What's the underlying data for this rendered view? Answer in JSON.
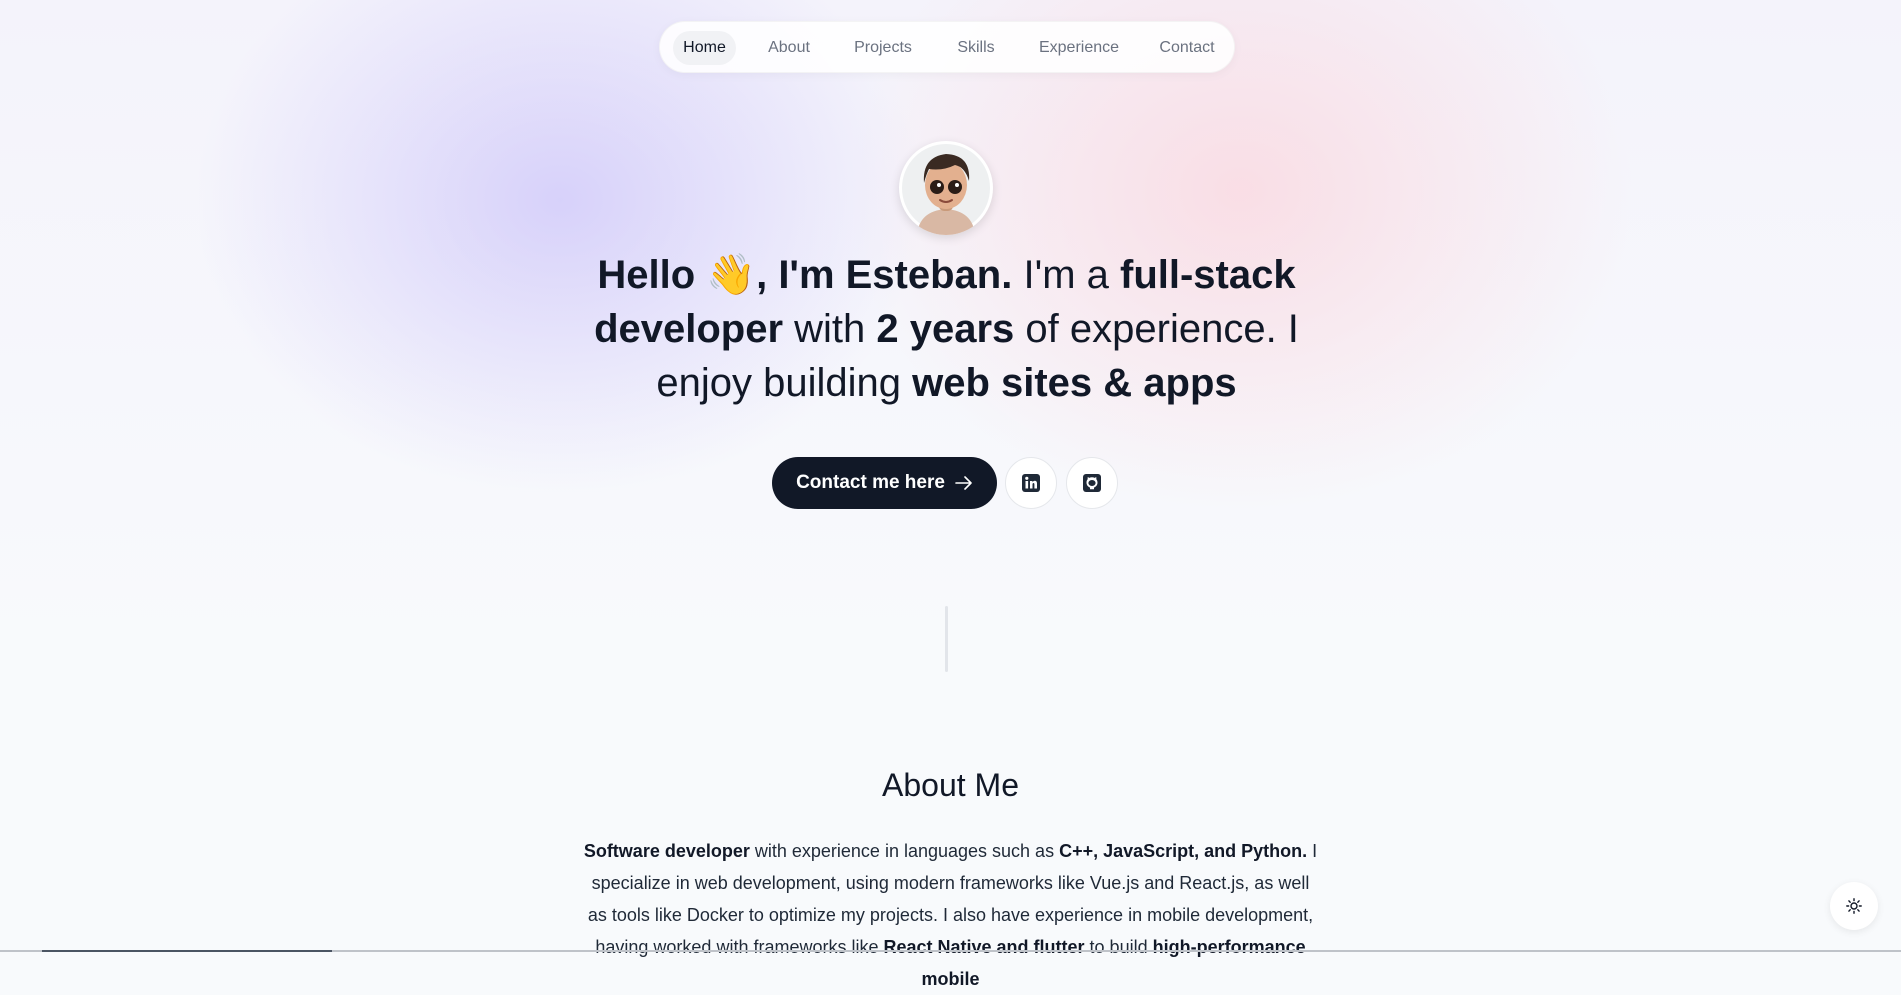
{
  "nav": {
    "items": [
      {
        "label": "Home",
        "active": true
      },
      {
        "label": "About"
      },
      {
        "label": "Projects"
      },
      {
        "label": "Skills"
      },
      {
        "label": "Experience"
      },
      {
        "label": "Contact"
      }
    ]
  },
  "hero": {
    "avatar_icon": "memoji-avatar",
    "greeting": "Hello ",
    "wave_emoji": "👋",
    "name": ", I'm Esteban.",
    "t1": " I'm a ",
    "role": "full-stack developer",
    "t2": " with ",
    "years": "2 years",
    "t3": " of experience. I enjoy building ",
    "focus": "web sites & apps"
  },
  "cta": {
    "label": "Contact me here",
    "arrow_icon": "arrow-right-icon"
  },
  "socials": [
    {
      "icon": "linkedin-icon"
    },
    {
      "icon": "github-icon"
    }
  ],
  "about": {
    "title": "About Me",
    "p1_b1": "Software developer",
    "p1_t1": " with experience in languages such as ",
    "p1_b2": "C++, JavaScript, and Python.",
    "p1_t2": " I specialize in web development, using modern frameworks like Vue.js and React.js, as well as tools like Docker to optimize my projects. I also have experience in mobile development, having worked with frameworks like ",
    "p1_b3": "React Native and flutter",
    "p1_t3": " to build ",
    "p1_b4": "high-performance mobile"
  },
  "theme_toggle": {
    "icon": "sun-icon"
  },
  "colors": {
    "accent": "#111827",
    "muted": "#6b7280"
  }
}
